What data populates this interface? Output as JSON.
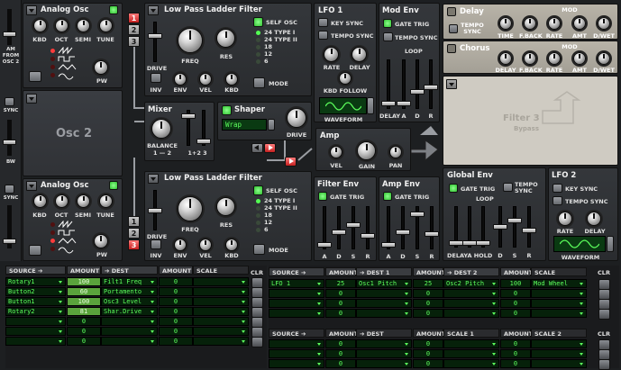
{
  "left_strip": {
    "label": "AM FROM OSC 2",
    "sync1": "SYNC",
    "bw": "BW",
    "sync2": "SYNC"
  },
  "osc1": {
    "title": "Analog Osc",
    "knobs": [
      "KBD",
      "OCT",
      "SEMI",
      "TUNE"
    ],
    "pw": "PW"
  },
  "osc2": {
    "title": "Osc 2"
  },
  "osc3": {
    "title": "Analog Osc",
    "knobs": [
      "KBD",
      "OCT",
      "SEMI",
      "TUNE"
    ],
    "pw": "PW"
  },
  "num_buttons": [
    "1",
    "2",
    "3"
  ],
  "filter1": {
    "title": "Low Pass Ladder Filter",
    "self_osc": "SELF OSC",
    "types": [
      "24 TYPE I",
      "24 TYPE II",
      "18",
      "12",
      "6"
    ],
    "drive": "DRIVE",
    "freq": "FREQ",
    "res": "RES",
    "inv": "INV",
    "env": "ENV",
    "vel": "VEL",
    "kbd": "KBD",
    "mode": "MODE"
  },
  "filter2": {
    "title": "Low Pass Ladder Filter",
    "self_osc": "SELF OSC",
    "types": [
      "24 TYPE I",
      "24 TYPE II",
      "18",
      "12",
      "6"
    ],
    "drive": "DRIVE",
    "freq": "FREQ",
    "res": "RES",
    "inv": "INV",
    "env": "ENV",
    "vel": "VEL",
    "kbd": "KBD",
    "mode": "MODE"
  },
  "mixer": {
    "title": "Mixer",
    "balance": "BALANCE",
    "bal_sub": "1 — 2",
    "mix_sub": "1+2  3"
  },
  "shaper": {
    "title": "Shaper",
    "mode": "Wrap",
    "drive": "DRIVE"
  },
  "amp": {
    "title": "Amp",
    "knobs": [
      "VEL",
      "GAIN",
      "PAN"
    ]
  },
  "lfo1": {
    "title": "LFO 1",
    "key_sync": "KEY SYNC",
    "tempo_sync": "TEMPO SYNC",
    "rate": "RATE",
    "delay": "DELAY",
    "kbd_follow": "KBD FOLLOW",
    "waveform": "WAVEFORM"
  },
  "mod_env": {
    "title": "Mod Env",
    "gate_trig": "GATE TRIG",
    "tempo_sync": "TEMPO SYNC",
    "loop": "LOOP",
    "delay": "DELAY",
    "a": "A",
    "d": "D",
    "r": "R"
  },
  "delay_fx": {
    "title": "Delay",
    "tempo_sync": "TEMPO SYNC",
    "mod": "MOD",
    "knobs": [
      "TIME",
      "F.BACK",
      "RATE",
      "AMT",
      "D/WET"
    ]
  },
  "chorus_fx": {
    "title": "Chorus",
    "mod": "MOD",
    "knobs": [
      "DELAY",
      "F.BACK",
      "RATE",
      "AMT",
      "D/WET"
    ]
  },
  "filter3": {
    "title": "Filter 3",
    "sub": "Bypass"
  },
  "filter_env": {
    "title": "Filter Env",
    "gate_trig": "GATE TRIG",
    "a": "A",
    "d": "D",
    "s": "S",
    "r": "R"
  },
  "amp_env": {
    "title": "Amp Env",
    "gate_trig": "GATE TRIG",
    "a": "A",
    "d": "D",
    "s": "S",
    "r": "R"
  },
  "global_env": {
    "title": "Global Env",
    "gate_trig": "GATE TRIG",
    "tempo_sync": "TEMPO SYNC",
    "loop": "LOOP",
    "delay": "DELAY",
    "a": "A",
    "hold": "HOLD",
    "d": "D",
    "s": "S",
    "r": "R"
  },
  "lfo2": {
    "title": "LFO 2",
    "key_sync": "KEY SYNC",
    "tempo_sync": "TEMPO SYNC",
    "rate": "RATE",
    "delay": "DELAY",
    "waveform": "WAVEFORM"
  },
  "mod_left": {
    "headers": [
      "SOURCE ➔",
      "AMOUNT",
      "➔ DEST",
      "AMOUNT",
      "SCALE"
    ],
    "clr": "CLR",
    "rows": [
      [
        "Rotary1",
        "100",
        "Filt1 Freq",
        "0",
        ""
      ],
      [
        "Button2",
        "60",
        "Portamento",
        "0",
        ""
      ],
      [
        "Button1",
        "100",
        "Osc3 Level",
        "0",
        ""
      ],
      [
        "Rotary2",
        "81",
        "Shar.Drive",
        "0",
        ""
      ],
      [
        "",
        "0",
        "",
        "0",
        ""
      ],
      [
        "",
        "0",
        "",
        "0",
        ""
      ],
      [
        "",
        "0",
        "",
        "0",
        ""
      ]
    ]
  },
  "mod_right_top": {
    "headers": [
      "SOURCE ➔",
      "AMOUNT",
      "➔ DEST 1",
      "AMOUNT",
      "➔ DEST 2",
      "AMOUNT",
      "SCALE"
    ],
    "clr": "CLR",
    "rows": [
      [
        "LFO 1",
        "25",
        "Osc1 Pitch",
        "25",
        "Osc2 Pitch",
        "100",
        "Mod Wheel"
      ],
      [
        "",
        "0",
        "",
        "0",
        "",
        "0",
        ""
      ],
      [
        "",
        "0",
        "",
        "0",
        "",
        "0",
        ""
      ],
      [
        "",
        "0",
        "",
        "0",
        "",
        "0",
        ""
      ]
    ]
  },
  "mod_right_bottom": {
    "headers": [
      "SOURCE ➔",
      "AMOUNT",
      "➔ DEST",
      "AMOUNT",
      "SCALE 1",
      "AMOUNT",
      "SCALE 2"
    ],
    "clr": "CLR",
    "rows": [
      [
        "",
        "0",
        "",
        "0",
        "",
        "0",
        ""
      ],
      [
        "",
        "0",
        "",
        "0",
        "",
        "0",
        ""
      ],
      [
        "",
        "0",
        "",
        "0",
        "",
        "0",
        ""
      ]
    ]
  }
}
